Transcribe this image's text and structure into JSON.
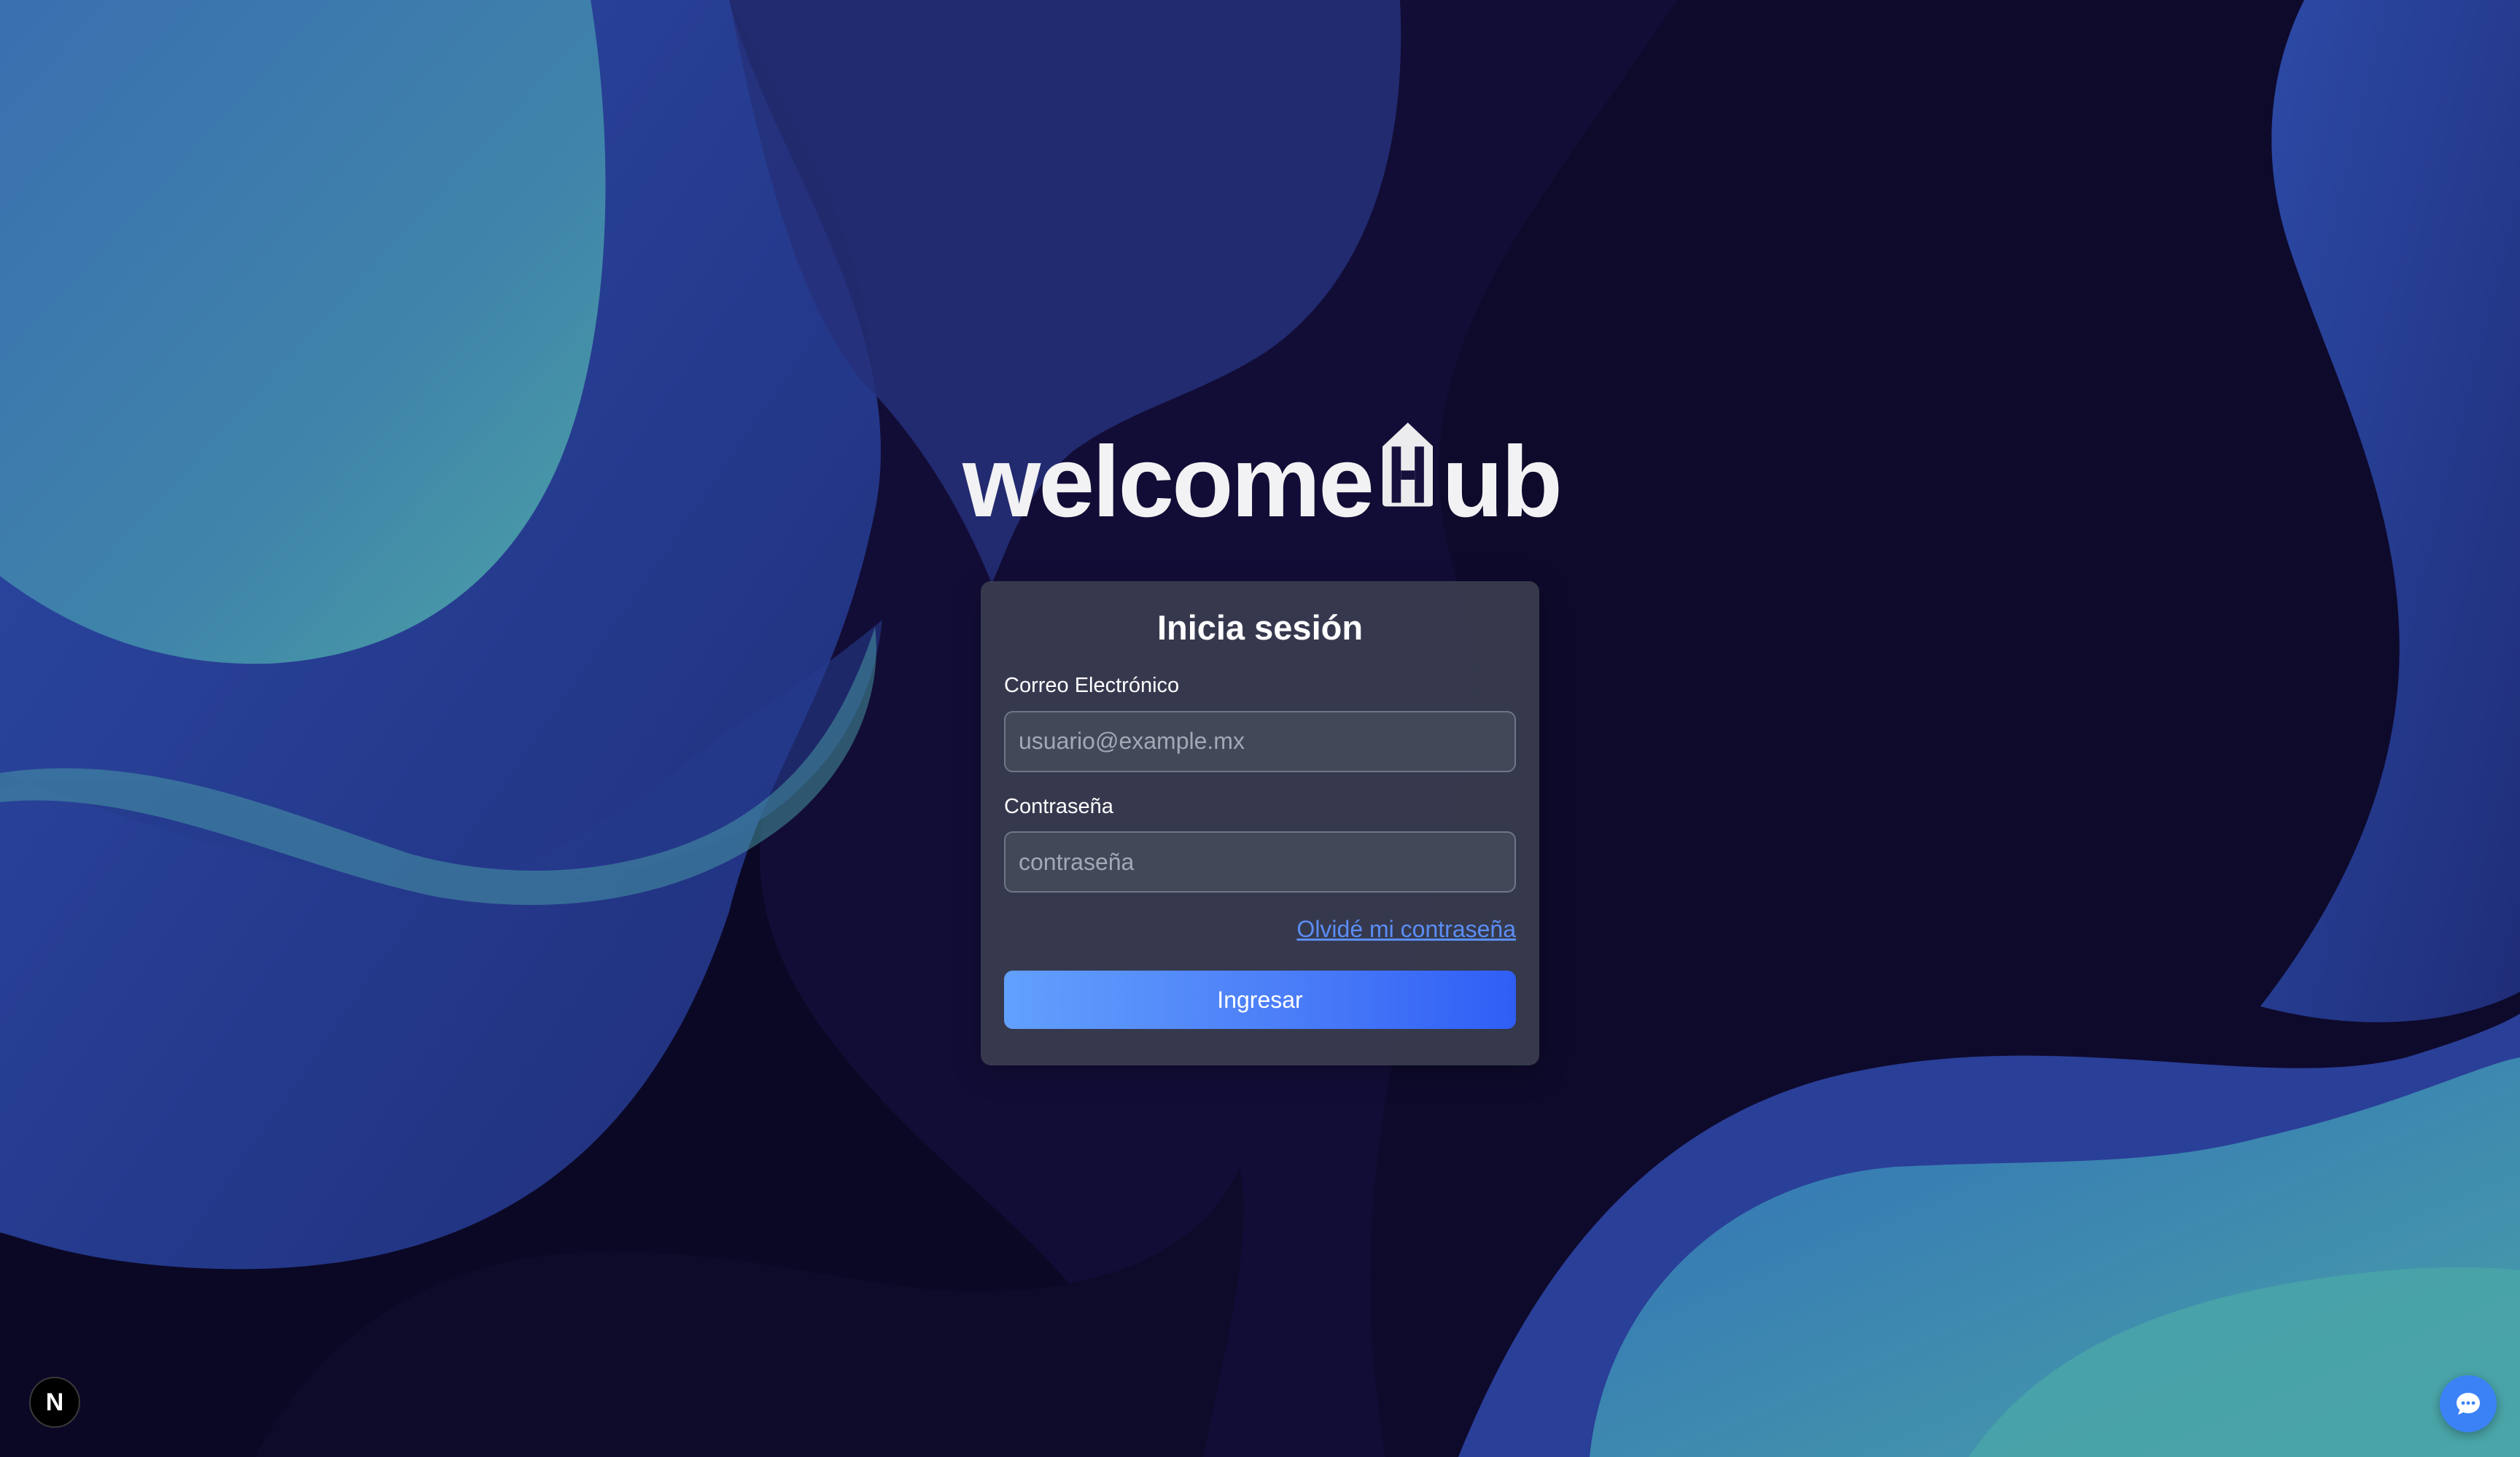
{
  "logo": {
    "text_before": "welcome",
    "text_after": "ub"
  },
  "login": {
    "title": "Inicia sesión",
    "email_label": "Correo Electrónico",
    "email_placeholder": "usuario@example.mx",
    "email_value": "",
    "password_label": "Contraseña",
    "password_placeholder": "contraseña",
    "password_value": "",
    "forgot_link": "Olvidé mi contraseña",
    "submit_label": "Ingresar"
  },
  "floating": {
    "next_badge_letter": "N",
    "chat_icon": "chat-bubble-icon"
  },
  "colors": {
    "accent": "#3b82f6",
    "link": "#5b8df6",
    "card_bg": "#404654",
    "background": "#0b0826"
  }
}
